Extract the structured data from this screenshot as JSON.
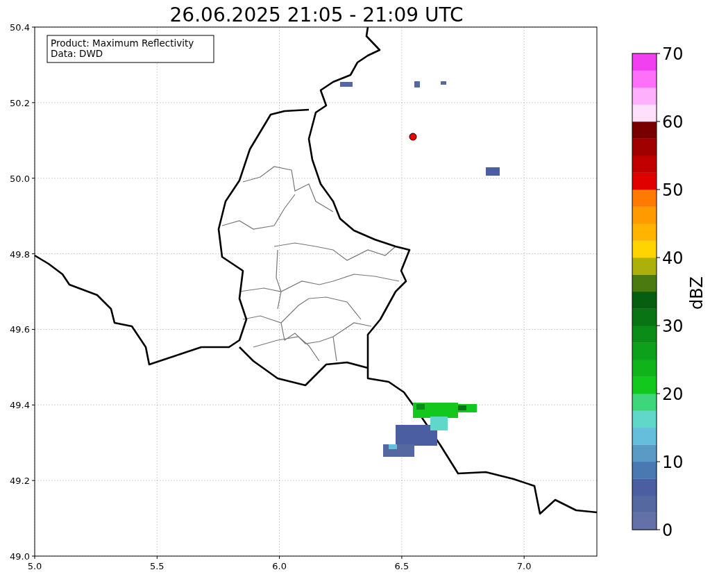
{
  "title": "26.06.2025 21:05 - 21:09 UTC",
  "info_box": [
    "Product: Maximum Reflectivity",
    "Data: DWD"
  ],
  "map": {
    "xticks": [
      "5.0",
      "5.5",
      "6.0",
      "6.5",
      "7.0"
    ],
    "yticks": [
      "50.4",
      "50.2",
      "50.0",
      "49.8",
      "49.6",
      "49.4",
      "49.2",
      "49.0"
    ]
  },
  "colorbar": {
    "label": "dBZ",
    "ticks": [
      "70",
      "60",
      "50",
      "40",
      "30",
      "20",
      "10",
      "0"
    ],
    "segments": [
      {
        "color": "#6272a8"
      },
      {
        "color": "#55689f"
      },
      {
        "color": "#4a5ea1"
      },
      {
        "color": "#4a78b0"
      },
      {
        "color": "#5a9bc6"
      },
      {
        "color": "#64bedc"
      },
      {
        "color": "#60d7c8"
      },
      {
        "color": "#3ed67a"
      },
      {
        "color": "#12c81c"
      },
      {
        "color": "#10b41a"
      },
      {
        "color": "#0da01a"
      },
      {
        "color": "#0b8c18"
      },
      {
        "color": "#087414"
      },
      {
        "color": "#075e10"
      },
      {
        "color": "#4a7a10"
      },
      {
        "color": "#adb00a"
      },
      {
        "color": "#ffd400"
      },
      {
        "color": "#ffb400"
      },
      {
        "color": "#ff9a00"
      },
      {
        "color": "#ff7a00"
      },
      {
        "color": "#e00000"
      },
      {
        "color": "#c00000"
      },
      {
        "color": "#a00000"
      },
      {
        "color": "#780000"
      },
      {
        "color": "#ffe0fc"
      },
      {
        "color": "#ffb0fc"
      },
      {
        "color": "#ff70f8"
      },
      {
        "color": "#f040f0"
      }
    ]
  }
}
